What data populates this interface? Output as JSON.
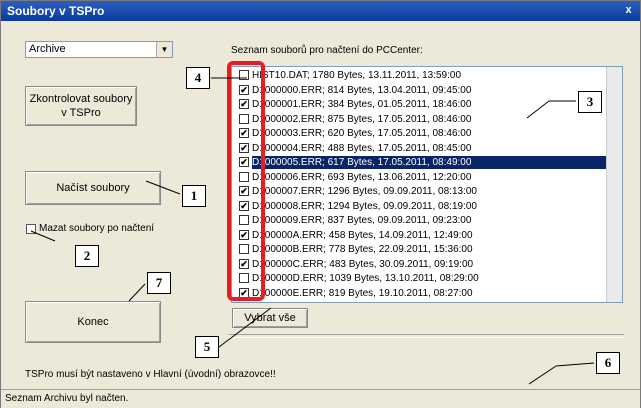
{
  "window": {
    "title": "Soubory v TSPro",
    "close": "x"
  },
  "archive_select": {
    "value": "Archive",
    "arrow": "▼"
  },
  "buttons": {
    "check": "Zkontrolovat soubory v TSPro",
    "load": "Načíst soubory",
    "end": "Konec",
    "select_all": "Vybrat vše"
  },
  "delete_after_load": {
    "label": "Mazat soubory po načtení",
    "checked": false
  },
  "file_list": {
    "caption": "Seznam souborů pro načtení do PCCenter:",
    "items": [
      {
        "text": "HIST10.DAT; 1780 Bytes, 13.11.2011, 13:59:00",
        "checked": false,
        "selected": false
      },
      {
        "text": "D1000000.ERR; 814 Bytes, 13.04.2011, 09:45:00",
        "checked": true,
        "selected": false
      },
      {
        "text": "D1000001.ERR; 384 Bytes, 01.05.2011, 18:46:00",
        "checked": true,
        "selected": false
      },
      {
        "text": "D1000002.ERR; 875 Bytes, 17.05.2011, 08:46:00",
        "checked": false,
        "selected": false
      },
      {
        "text": "D1000003.ERR; 620 Bytes, 17.05.2011, 08:46:00",
        "checked": true,
        "selected": false
      },
      {
        "text": "D1000004.ERR; 488 Bytes, 17.05.2011, 08:45:00",
        "checked": true,
        "selected": false
      },
      {
        "text": "D1000005.ERR; 617 Bytes, 17.05.2011, 08:49:00",
        "checked": true,
        "selected": true
      },
      {
        "text": "D1000006.ERR; 693 Bytes, 13.06.2011, 12:20:00",
        "checked": false,
        "selected": false
      },
      {
        "text": "D1000007.ERR; 1296 Bytes, 09.09.2011, 08:13:00",
        "checked": true,
        "selected": false
      },
      {
        "text": "D1000008.ERR; 1294 Bytes, 09.09.2011, 08:19:00",
        "checked": true,
        "selected": false
      },
      {
        "text": "D1000009.ERR; 837 Bytes, 09.09.2011, 09:23:00",
        "checked": false,
        "selected": false
      },
      {
        "text": "D100000A.ERR; 458 Bytes, 14.09.2011, 12:49:00",
        "checked": true,
        "selected": false
      },
      {
        "text": "D100000B.ERR; 778 Bytes, 22.09.2011, 15:36:00",
        "checked": false,
        "selected": false
      },
      {
        "text": "D100000C.ERR; 483 Bytes, 30.09.2011, 09:19:00",
        "checked": true,
        "selected": false
      },
      {
        "text": "D100000D.ERR; 1039 Bytes, 13.10.2011, 08:29:00",
        "checked": false,
        "selected": false
      },
      {
        "text": "D100000E.ERR; 819 Bytes, 19.10.2011, 08:27:00",
        "checked": true,
        "selected": false
      }
    ]
  },
  "notice": "TSPro musí být nastaveno v Hlavní (úvodní) obrazovce!!",
  "status": "Seznam Archivu byl načten.",
  "callouts": [
    "1",
    "2",
    "3",
    "4",
    "5",
    "6",
    "7"
  ],
  "colors": {
    "highlight": "#e31e24",
    "selection": "#0a246a",
    "titlebar": "#0b3a9e"
  },
  "check_mark": "✔"
}
